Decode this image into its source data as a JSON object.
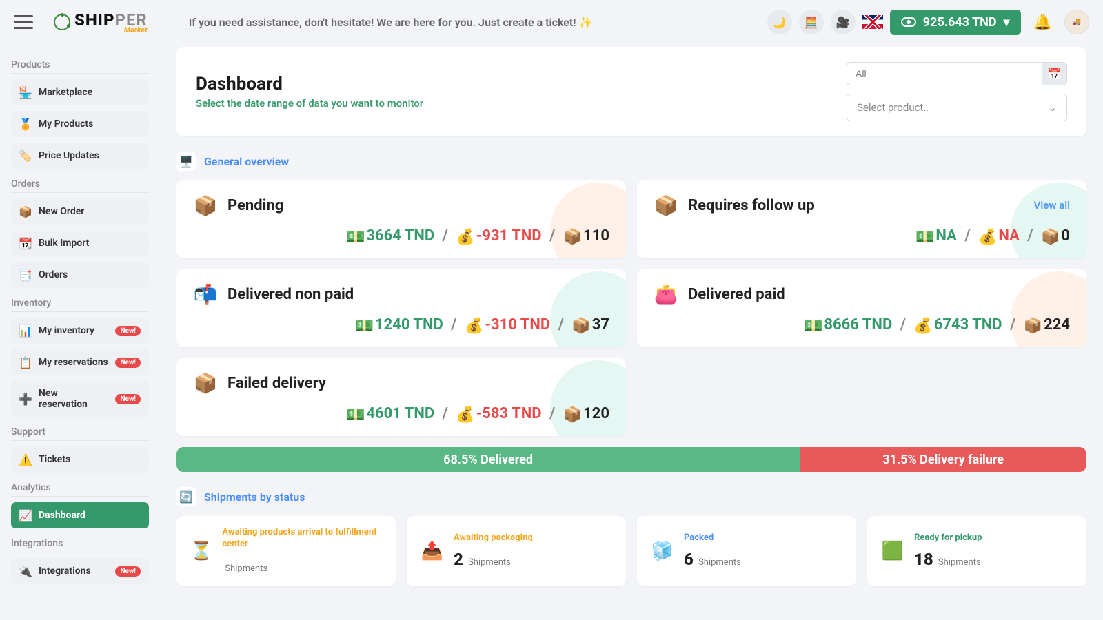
{
  "topbar": {
    "assist_msg": "If you need assistance, don't hesitate! We are here for you. Just create a ticket! ✨",
    "balance": "925.643 TND"
  },
  "logo": {
    "part1": "SHIP",
    "part2": "PER",
    "sub": "Market"
  },
  "sidebar": {
    "groups": [
      {
        "title": "Products",
        "items": [
          {
            "icon": "🏪",
            "label": "Marketplace"
          },
          {
            "icon": "🏅",
            "label": "My Products"
          },
          {
            "icon": "🏷️",
            "label": "Price Updates"
          }
        ]
      },
      {
        "title": "Orders",
        "items": [
          {
            "icon": "📦",
            "label": "New Order"
          },
          {
            "icon": "📆",
            "label": "Bulk Import"
          },
          {
            "icon": "📑",
            "label": "Orders"
          }
        ]
      },
      {
        "title": "Inventory",
        "items": [
          {
            "icon": "📊",
            "label": "My inventory",
            "badge": "New!"
          },
          {
            "icon": "📋",
            "label": "My reservations",
            "badge": "New!"
          },
          {
            "icon": "➕",
            "label": "New reservation",
            "badge": "New!"
          }
        ]
      },
      {
        "title": "Support",
        "items": [
          {
            "icon": "⚠️",
            "label": "Tickets"
          }
        ]
      },
      {
        "title": "Analytics",
        "items": [
          {
            "icon": "📈",
            "label": "Dashboard",
            "active": true
          }
        ]
      },
      {
        "title": "Integrations",
        "items": [
          {
            "icon": "🔌",
            "label": "Integrations",
            "badge": "New!"
          }
        ]
      }
    ]
  },
  "dashboard": {
    "title": "Dashboard",
    "subtitle": "Select the date range of data you want to monitor",
    "filter_all": "All",
    "filter_product": "Select product.."
  },
  "overview": {
    "title": "General overview",
    "cards": [
      {
        "title": "Pending",
        "v1": "3664 TND",
        "v2": "-931 TND",
        "v3": "110",
        "icon": "📦",
        "blob": "peach"
      },
      {
        "title": "Requires follow up",
        "v1": "NA",
        "v2": "NA",
        "v3": "0",
        "icon": "📦",
        "blob": "teal",
        "view_all": "View all"
      },
      {
        "title": "Delivered non paid",
        "v1": "1240 TND",
        "v2": "-310 TND",
        "v3": "37",
        "icon": "📬",
        "blob": "teal"
      },
      {
        "title": "Delivered paid",
        "v1": "8666 TND",
        "v2": "6743 TND",
        "v3": "224",
        "icon": "👛",
        "blob": "peach",
        "v2class": "v-green"
      },
      {
        "title": "Failed delivery",
        "v1": "4601 TND",
        "v2": "-583 TND",
        "v3": "120",
        "icon": "📦",
        "blob": "teal"
      }
    ]
  },
  "progress": {
    "delivered_pct": 68.5,
    "delivered_text": "68.5% Delivered",
    "failure_pct": 31.5,
    "failure_text": "31.5% Delivery failure"
  },
  "shipments": {
    "title": "Shipments by status",
    "cards": [
      {
        "icon": "⏳",
        "title": "Awaiting products arrival to fulfillment center",
        "count": "",
        "label": "Shipments",
        "cls": ""
      },
      {
        "icon": "📤",
        "title": "Awaiting packaging",
        "count": "2",
        "label": "Shipments",
        "cls": ""
      },
      {
        "icon": "🧊",
        "title": "Packed",
        "count": "6",
        "label": "Shipments",
        "cls": "blue"
      },
      {
        "icon": "🟩",
        "title": "Ready for pickup",
        "count": "18",
        "label": "Shipments",
        "cls": "green"
      }
    ]
  }
}
